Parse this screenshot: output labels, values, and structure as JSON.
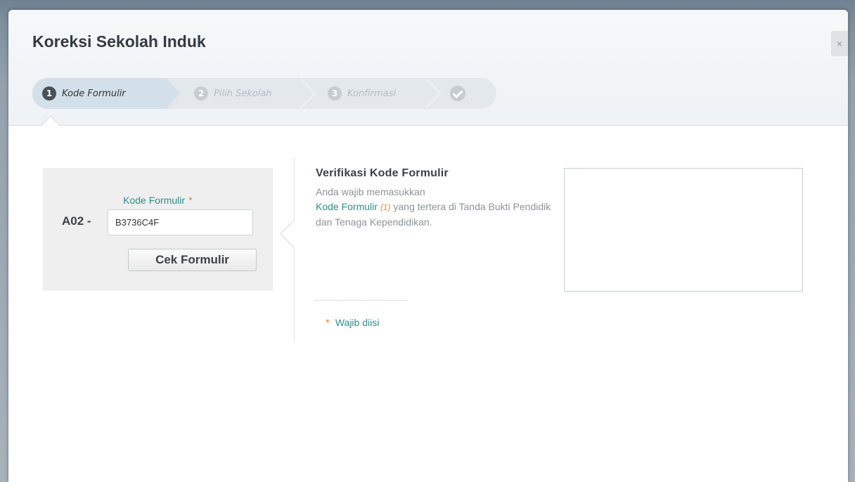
{
  "dialog": {
    "title": "Koreksi Sekolah Induk",
    "close_label": "×"
  },
  "wizard": {
    "steps": [
      {
        "number": "1",
        "label": "Kode Formulir",
        "state": "active"
      },
      {
        "number": "2",
        "label": "Pilih Sekolah",
        "state": "inactive"
      },
      {
        "number": "3",
        "label": "Konfirmasi",
        "state": "inactive"
      },
      {
        "number": "",
        "label": "",
        "icon": "check-icon",
        "state": "inactive"
      }
    ]
  },
  "form": {
    "field_label": "Kode Formulir",
    "required_marker": "*",
    "prefix": "A02 -",
    "code_value": "B3736C4F",
    "submit_label": "Cek Formulir"
  },
  "info": {
    "title": "Verifikasi Kode Formulir",
    "text_part1": "Anda wajib memasukkan",
    "link_text": "Kode Formulir",
    "ref": "(1)",
    "text_part2": "yang tertera di Tanda Bukti Pendidik dan Tenaga Kependidikan."
  },
  "legend": {
    "marker": "*",
    "text": "Wajib diisi"
  },
  "colors": {
    "accent": "#2f8d86",
    "required": "#f08a24"
  }
}
